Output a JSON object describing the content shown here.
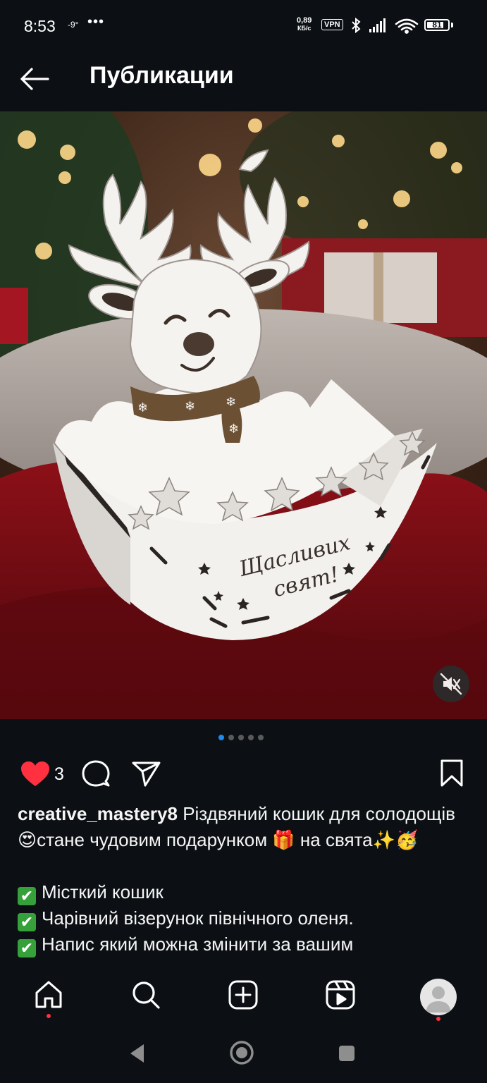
{
  "status_bar": {
    "time": "8:53",
    "temperature": "-9°",
    "more": "•••",
    "speed_value": "0,89",
    "speed_unit": "КБ/с",
    "vpn": "VPN",
    "battery": "81",
    "battery_level": 0.81
  },
  "header": {
    "title": "Публикации",
    "back_icon": "arrow-left-icon"
  },
  "post": {
    "image_text_line1": "Щасливих",
    "image_text_line2": "свят!",
    "carousel_total": 5,
    "carousel_active": 1,
    "like_count": "3",
    "caption": {
      "username": "creative_mastery8",
      "text_part1": " Різдвяний кошик для солодощів ",
      "emoji1": "😍",
      "text_part2": "стане чудовим подарунком ",
      "emoji2": "🎁",
      "text_part3": " на свята",
      "emoji3": "✨🥳",
      "check_mark": "✔",
      "bullets": [
        "Місткий кошик",
        "Чарівний візерунок північного оленя.",
        "Напис який можна змінити за вашим"
      ]
    }
  },
  "colors": {
    "background": "#0c1014",
    "accent": "#1d8bf0",
    "like": "#ff3040",
    "check": "#36a13a"
  },
  "icons": {
    "mute": "speaker-muted-icon",
    "like": "heart-filled-icon",
    "comment": "comment-bubble-icon",
    "share": "paper-plane-icon",
    "save": "bookmark-icon",
    "nav": [
      "home-icon",
      "search-icon",
      "create-icon",
      "reels-icon",
      "profile-avatar"
    ]
  }
}
